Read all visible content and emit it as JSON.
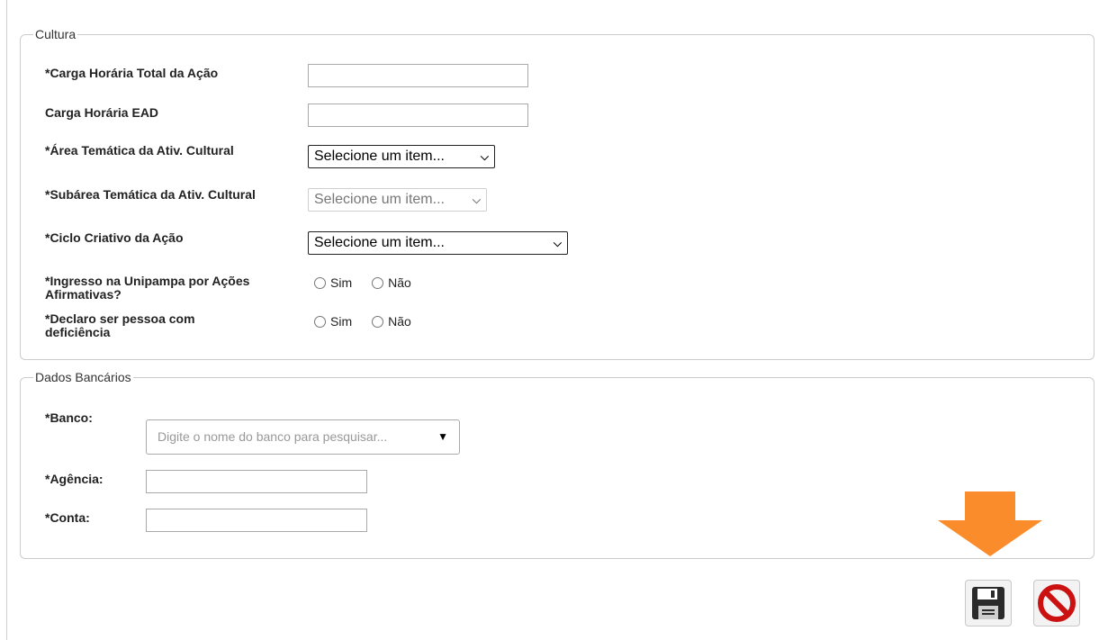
{
  "cultura": {
    "legend": "Cultura",
    "carga_total": {
      "label": "*Carga Horária Total da Ação",
      "value": ""
    },
    "carga_ead": {
      "label": "Carga Horária EAD",
      "value": ""
    },
    "area_tematica": {
      "label": "*Área Temática da Ativ. Cultural",
      "selected": "Selecione um item..."
    },
    "subarea_tematica": {
      "label": "*Subárea Temática da Ativ. Cultural",
      "selected": "Selecione um item..."
    },
    "ciclo_criativo": {
      "label": "*Ciclo Criativo da Ação",
      "selected": "Selecione um item..."
    },
    "ingresso": {
      "label_line1": "*Ingresso na Unipampa por Ações",
      "label_line2": "Afirmativas?",
      "opt_yes": "Sim",
      "opt_no": "Não"
    },
    "deficiencia": {
      "label_line1": "*Declaro ser pessoa com",
      "label_line2": "deficiência",
      "opt_yes": "Sim",
      "opt_no": "Não"
    }
  },
  "bancarios": {
    "legend": "Dados Bancários",
    "banco": {
      "label": "*Banco:",
      "placeholder": "Digite o nome do banco para pesquisar..."
    },
    "agencia": {
      "label": "*Agência:",
      "value": ""
    },
    "conta": {
      "label": "*Conta:",
      "value": ""
    }
  },
  "colors": {
    "arrow": "#fb8c2c",
    "cancel": "#cc1111",
    "save": "#2b2b2b"
  },
  "icons": {
    "save": "floppy-disk-icon",
    "cancel": "no-entry-icon",
    "pointer": "down-arrow-icon"
  }
}
